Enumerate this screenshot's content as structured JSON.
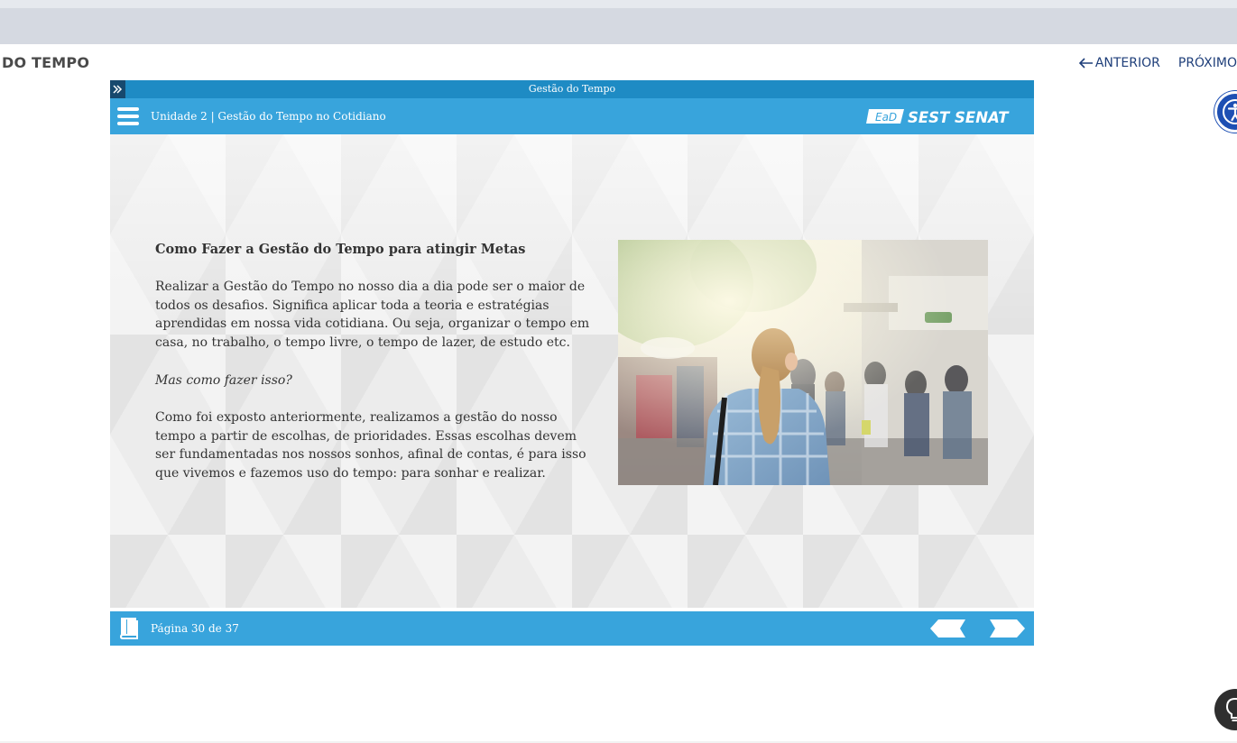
{
  "page": {
    "title": "DO TEMPO",
    "nav_prev_label": "ANTERIOR",
    "nav_next_label": "PRÓXIMO"
  },
  "player": {
    "course_title": "Gestão do Tempo",
    "unit_title": "Unidade 2 | Gestão do Tempo no Cotidiano",
    "logo": {
      "badge_text": "EaD",
      "brand_text": "SEST SENAT"
    },
    "pagination": "Página 30 de 37"
  },
  "content": {
    "heading": "Como Fazer a Gestão do Tempo para atingir Metas",
    "paragraph_1": "Realizar a Gestão do Tempo no nosso dia a dia pode ser o maior de todos os desafios. Significa aplicar toda a teoria e estratégias aprendidas em nossa vida cotidiana. Ou seja, organizar o tempo em casa, no trabalho, o tempo livre, o tempo de lazer, de estudo etc.",
    "question": "Mas como fazer isso?",
    "paragraph_2": "Como foi exposto anteriormente, realizamos a gestão do nosso tempo a partir de escolhas, de prioridades. Essas escolhas devem ser fundamentadas nos nossos sonhos, afinal de contas, é para isso que vivemos e fazemos uso do tempo: para sonhar e realizar."
  },
  "icons": {
    "expand": "double-chevron-right-icon",
    "menu": "hamburger-menu-icon",
    "book": "book-icon",
    "prev": "arrow-left-icon",
    "next": "arrow-right-icon",
    "accessibility": "accessibility-icon",
    "hint": "lightbulb-icon"
  },
  "colors": {
    "header_blue": "#38a4dc",
    "title_blue": "#1e8bc4",
    "nav_text": "#1f3f7a",
    "accessibility_blue": "#1d4fb3"
  }
}
